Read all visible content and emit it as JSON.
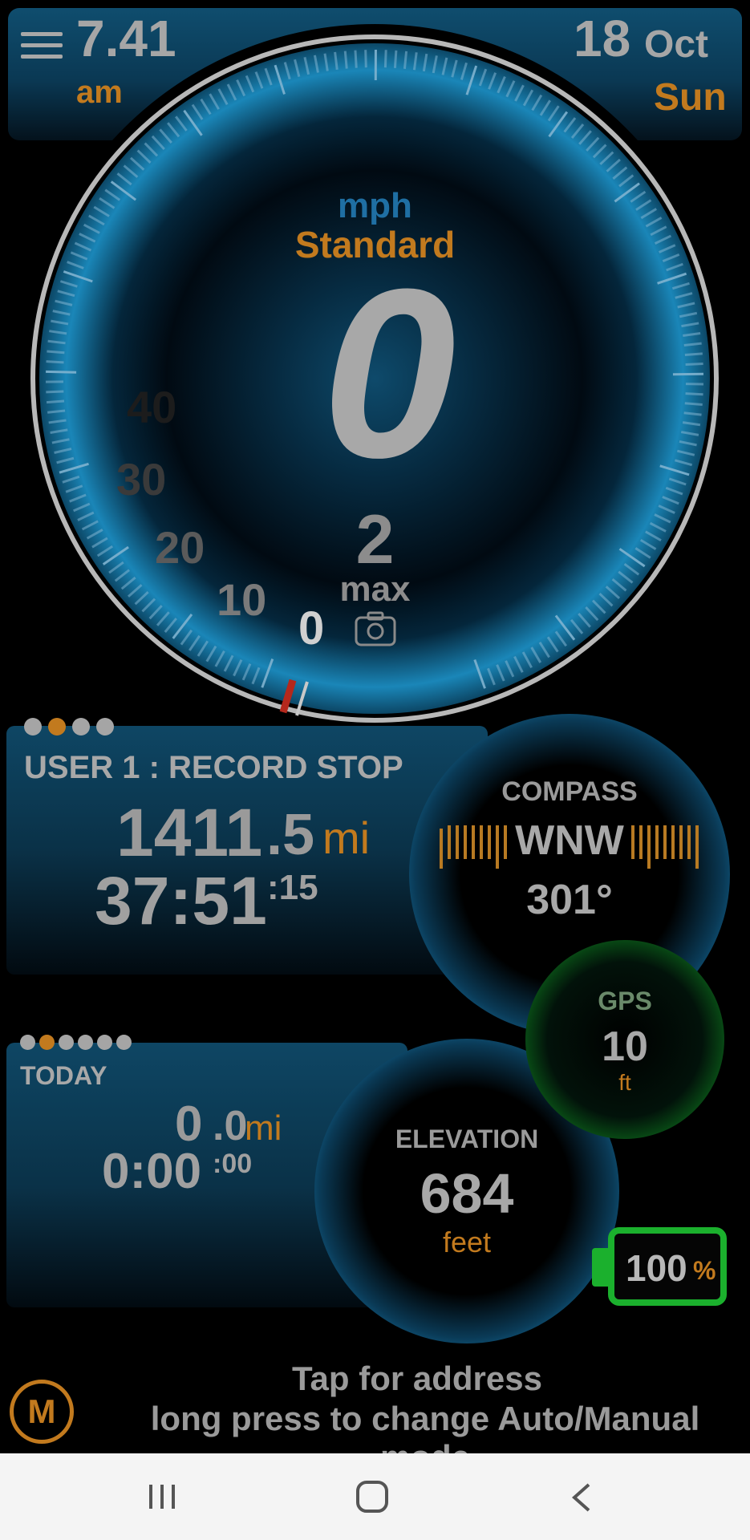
{
  "header": {
    "time": "7.41",
    "ampm": "am",
    "date_day": "18",
    "date_month": "Oct",
    "weekday": "Sun"
  },
  "speedometer": {
    "unit": "mph",
    "mode": "Standard",
    "speed": "0",
    "max_value": "2",
    "max_label": "max",
    "scale_labels": [
      "0",
      "10",
      "20",
      "30",
      "40"
    ]
  },
  "trip": {
    "title": "USER 1 : RECORD STOP",
    "distance_int": "1411",
    "distance_dec": ".5",
    "distance_unit": "mi",
    "time": "37:51",
    "time_sec": ":15"
  },
  "today": {
    "title": "TODAY",
    "distance_int": "0",
    "distance_dec": ".0",
    "distance_unit": "mi",
    "time": "0:00",
    "time_sec": ":00"
  },
  "compass": {
    "label": "COMPASS",
    "direction": "WNW",
    "degrees": "301°"
  },
  "gps": {
    "label": "GPS",
    "value": "10",
    "unit": "ft"
  },
  "elevation": {
    "label": "ELEVATION",
    "value": "684",
    "unit": "feet"
  },
  "battery": {
    "value": "100",
    "pct": "%"
  },
  "footer": {
    "mode_button": "M",
    "address_line1": "Tap for address",
    "address_line2": "long press to change Auto/Manual mode"
  },
  "colors": {
    "accent_orange": "#c27a1e",
    "accent_blue": "#1676a8",
    "gps_green": "#1bb02d"
  }
}
